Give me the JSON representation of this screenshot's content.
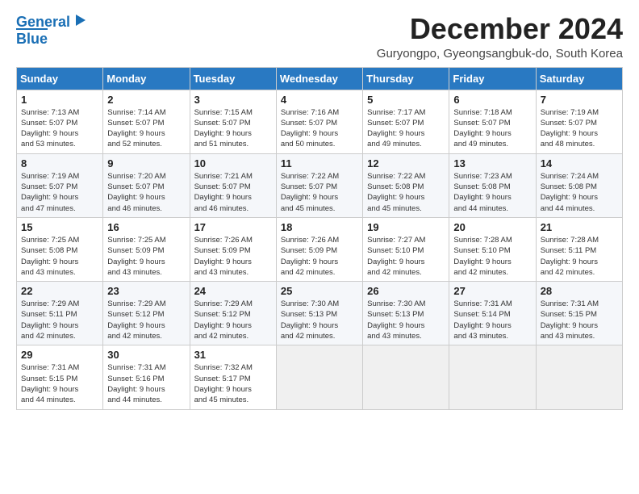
{
  "logo": {
    "line1": "General",
    "line2": "Blue"
  },
  "title": "December 2024",
  "location": "Guryongpo, Gyeongsangbuk-do, South Korea",
  "weekdays": [
    "Sunday",
    "Monday",
    "Tuesday",
    "Wednesday",
    "Thursday",
    "Friday",
    "Saturday"
  ],
  "weeks": [
    [
      {
        "day": 1,
        "sunrise": "7:13 AM",
        "sunset": "5:07 PM",
        "daylight": "9 hours and 53 minutes."
      },
      {
        "day": 2,
        "sunrise": "7:14 AM",
        "sunset": "5:07 PM",
        "daylight": "9 hours and 52 minutes."
      },
      {
        "day": 3,
        "sunrise": "7:15 AM",
        "sunset": "5:07 PM",
        "daylight": "9 hours and 51 minutes."
      },
      {
        "day": 4,
        "sunrise": "7:16 AM",
        "sunset": "5:07 PM",
        "daylight": "9 hours and 50 minutes."
      },
      {
        "day": 5,
        "sunrise": "7:17 AM",
        "sunset": "5:07 PM",
        "daylight": "9 hours and 49 minutes."
      },
      {
        "day": 6,
        "sunrise": "7:18 AM",
        "sunset": "5:07 PM",
        "daylight": "9 hours and 49 minutes."
      },
      {
        "day": 7,
        "sunrise": "7:19 AM",
        "sunset": "5:07 PM",
        "daylight": "9 hours and 48 minutes."
      }
    ],
    [
      {
        "day": 8,
        "sunrise": "7:19 AM",
        "sunset": "5:07 PM",
        "daylight": "9 hours and 47 minutes."
      },
      {
        "day": 9,
        "sunrise": "7:20 AM",
        "sunset": "5:07 PM",
        "daylight": "9 hours and 46 minutes."
      },
      {
        "day": 10,
        "sunrise": "7:21 AM",
        "sunset": "5:07 PM",
        "daylight": "9 hours and 46 minutes."
      },
      {
        "day": 11,
        "sunrise": "7:22 AM",
        "sunset": "5:07 PM",
        "daylight": "9 hours and 45 minutes."
      },
      {
        "day": 12,
        "sunrise": "7:22 AM",
        "sunset": "5:08 PM",
        "daylight": "9 hours and 45 minutes."
      },
      {
        "day": 13,
        "sunrise": "7:23 AM",
        "sunset": "5:08 PM",
        "daylight": "9 hours and 44 minutes."
      },
      {
        "day": 14,
        "sunrise": "7:24 AM",
        "sunset": "5:08 PM",
        "daylight": "9 hours and 44 minutes."
      }
    ],
    [
      {
        "day": 15,
        "sunrise": "7:25 AM",
        "sunset": "5:08 PM",
        "daylight": "9 hours and 43 minutes."
      },
      {
        "day": 16,
        "sunrise": "7:25 AM",
        "sunset": "5:09 PM",
        "daylight": "9 hours and 43 minutes."
      },
      {
        "day": 17,
        "sunrise": "7:26 AM",
        "sunset": "5:09 PM",
        "daylight": "9 hours and 43 minutes."
      },
      {
        "day": 18,
        "sunrise": "7:26 AM",
        "sunset": "5:09 PM",
        "daylight": "9 hours and 42 minutes."
      },
      {
        "day": 19,
        "sunrise": "7:27 AM",
        "sunset": "5:10 PM",
        "daylight": "9 hours and 42 minutes."
      },
      {
        "day": 20,
        "sunrise": "7:28 AM",
        "sunset": "5:10 PM",
        "daylight": "9 hours and 42 minutes."
      },
      {
        "day": 21,
        "sunrise": "7:28 AM",
        "sunset": "5:11 PM",
        "daylight": "9 hours and 42 minutes."
      }
    ],
    [
      {
        "day": 22,
        "sunrise": "7:29 AM",
        "sunset": "5:11 PM",
        "daylight": "9 hours and 42 minutes."
      },
      {
        "day": 23,
        "sunrise": "7:29 AM",
        "sunset": "5:12 PM",
        "daylight": "9 hours and 42 minutes."
      },
      {
        "day": 24,
        "sunrise": "7:29 AM",
        "sunset": "5:12 PM",
        "daylight": "9 hours and 42 minutes."
      },
      {
        "day": 25,
        "sunrise": "7:30 AM",
        "sunset": "5:13 PM",
        "daylight": "9 hours and 42 minutes."
      },
      {
        "day": 26,
        "sunrise": "7:30 AM",
        "sunset": "5:13 PM",
        "daylight": "9 hours and 43 minutes."
      },
      {
        "day": 27,
        "sunrise": "7:31 AM",
        "sunset": "5:14 PM",
        "daylight": "9 hours and 43 minutes."
      },
      {
        "day": 28,
        "sunrise": "7:31 AM",
        "sunset": "5:15 PM",
        "daylight": "9 hours and 43 minutes."
      }
    ],
    [
      {
        "day": 29,
        "sunrise": "7:31 AM",
        "sunset": "5:15 PM",
        "daylight": "9 hours and 44 minutes."
      },
      {
        "day": 30,
        "sunrise": "7:31 AM",
        "sunset": "5:16 PM",
        "daylight": "9 hours and 44 minutes."
      },
      {
        "day": 31,
        "sunrise": "7:32 AM",
        "sunset": "5:17 PM",
        "daylight": "9 hours and 45 minutes."
      },
      null,
      null,
      null,
      null
    ]
  ]
}
